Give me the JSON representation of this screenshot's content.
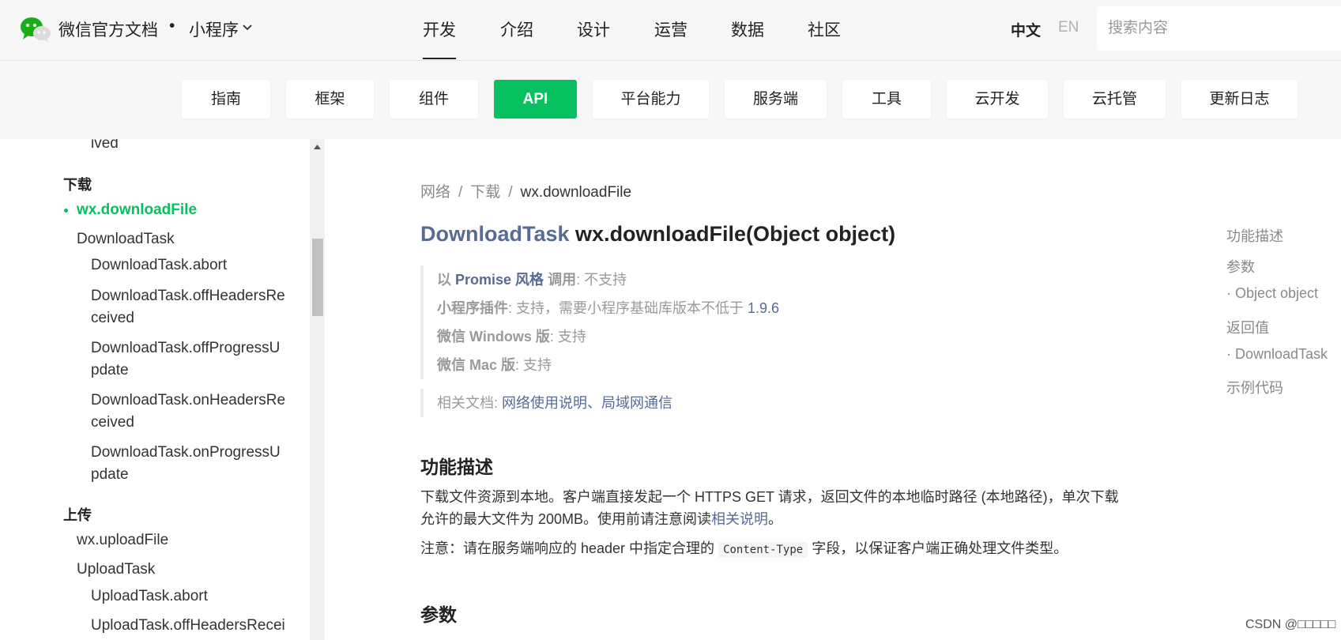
{
  "header": {
    "brand": "微信官方文档",
    "dot": "•",
    "product": "小程序",
    "nav": [
      {
        "label": "开发",
        "active": true
      },
      {
        "label": "介绍"
      },
      {
        "label": "设计"
      },
      {
        "label": "运营"
      },
      {
        "label": "数据"
      },
      {
        "label": "社区"
      }
    ],
    "lang_zh": "中文",
    "lang_en": "EN",
    "search_placeholder": "搜索内容"
  },
  "categories": [
    {
      "label": "指南"
    },
    {
      "label": "框架"
    },
    {
      "label": "组件"
    },
    {
      "label": "API",
      "active": true
    },
    {
      "label": "平台能力"
    },
    {
      "label": "服务端"
    },
    {
      "label": "工具"
    },
    {
      "label": "云开发"
    },
    {
      "label": "云托管"
    },
    {
      "label": "更新日志"
    }
  ],
  "sidebar": {
    "items": [
      {
        "label": "ived"
      },
      {
        "label": "下载"
      },
      {
        "label": "wx.downloadFile"
      },
      {
        "label": "DownloadTask"
      },
      {
        "label": "DownloadTask.abort"
      },
      {
        "label": "DownloadTask.offHeadersRe"
      },
      {
        "label": "ceived"
      },
      {
        "label": "DownloadTask.offProgressU"
      },
      {
        "label": "pdate"
      },
      {
        "label": "DownloadTask.onHeadersRe"
      },
      {
        "label": "ceived"
      },
      {
        "label": "DownloadTask.onProgressU"
      },
      {
        "label": "pdate"
      },
      {
        "label": "上传"
      },
      {
        "label": "wx.uploadFile"
      },
      {
        "label": "UploadTask"
      },
      {
        "label": "UploadTask.abort"
      },
      {
        "label": "UploadTask.offHeadersRecei"
      }
    ]
  },
  "breadcrumb": {
    "items": [
      "网络",
      "下载",
      "wx.downloadFile"
    ],
    "separator": "/"
  },
  "page": {
    "title_type": "DownloadTask",
    "title_sig": "wx.downloadFile(Object object)",
    "support": [
      {
        "k1": "以 ",
        "k_em": "Promise 风格",
        "k2": " 调用",
        "colon": ":",
        "v": " 不支持"
      },
      {
        "k1": "小程序插件",
        "colon": ":",
        "v": " 支持，需要小程序基础库版本不低于 ",
        "link": "1.9.6"
      },
      {
        "k1": "微信 Windows 版",
        "colon": ":",
        "v": " 支持"
      },
      {
        "k1": "微信 Mac 版",
        "colon": ":",
        "v": " 支持"
      }
    ],
    "related": {
      "label": "相关文档: ",
      "link1": "网络使用说明",
      "sep": "、",
      "link2": "局域网通信"
    },
    "section_desc": "功能描述",
    "desc_text": "下载文件资源到本地。客户端直接发起一个 HTTPS GET 请求，返回文件的本地临时路径 (本地路径)，单次下载允许的最大文件为 200MB。使用前请注意阅读",
    "desc_link": "相关说明",
    "desc_end": "。",
    "note_a": "注意：请在服务端响应的 header 中指定合理的 ",
    "note_code": "Content-Type",
    "note_b": " 字段，以保证客户端正确处理文件类型。",
    "section_params": "参数"
  },
  "toc": [
    "功能描述",
    "参数",
    "· Object object",
    "返回值",
    "· DownloadTask",
    "示例代码"
  ],
  "watermark": "CSDN @□□□□□",
  "colors": {
    "accent": "#07c160",
    "link": "#576b95"
  }
}
